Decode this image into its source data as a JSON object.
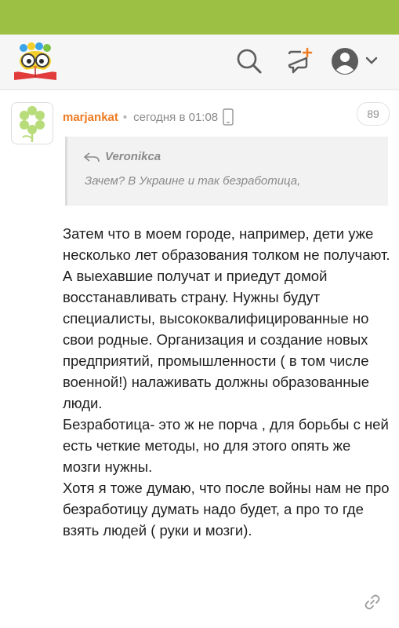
{
  "colors": {
    "topbar": "#9cc044",
    "author": "#ef7b22",
    "muted": "#8a8a8a"
  },
  "header": {
    "logo_icon": "owl-on-book-logo",
    "search_icon": "search-icon",
    "new_post_icon": "new-post-icon",
    "profile_icon": "user-avatar-icon",
    "dropdown_icon": "chevron-down-icon"
  },
  "comment": {
    "avatar_icon": "flower-avatar",
    "author": "marjankat",
    "separator": "•",
    "time": "сегодня в 01:08",
    "device_icon": "mobile-phone-icon",
    "number": "89",
    "quote": {
      "author": "Veronikca",
      "text": "Зачем? В Украине и так безработица,"
    },
    "paragraphs": [
      "Затем что в моем городе, например, дети уже несколько лет образования толком не получают. А выехавшие получат и приедут домой восстанавливать страну. Нужны будут специалисты, высококвалифицированные но свои родные. Организация и создание новых предприятий, промышленности ( в том числе военной!) налаживать должны образованные люди.",
      "Безработица- это ж не порча , для борьбы с ней есть четкие методы, но для этого опять же мозги нужны.",
      "Хотя я тоже думаю, что после войны нам не про безработицу думать надо будет, а про то где взять людей ( руки и мозги)."
    ],
    "link_icon": "link-icon"
  }
}
